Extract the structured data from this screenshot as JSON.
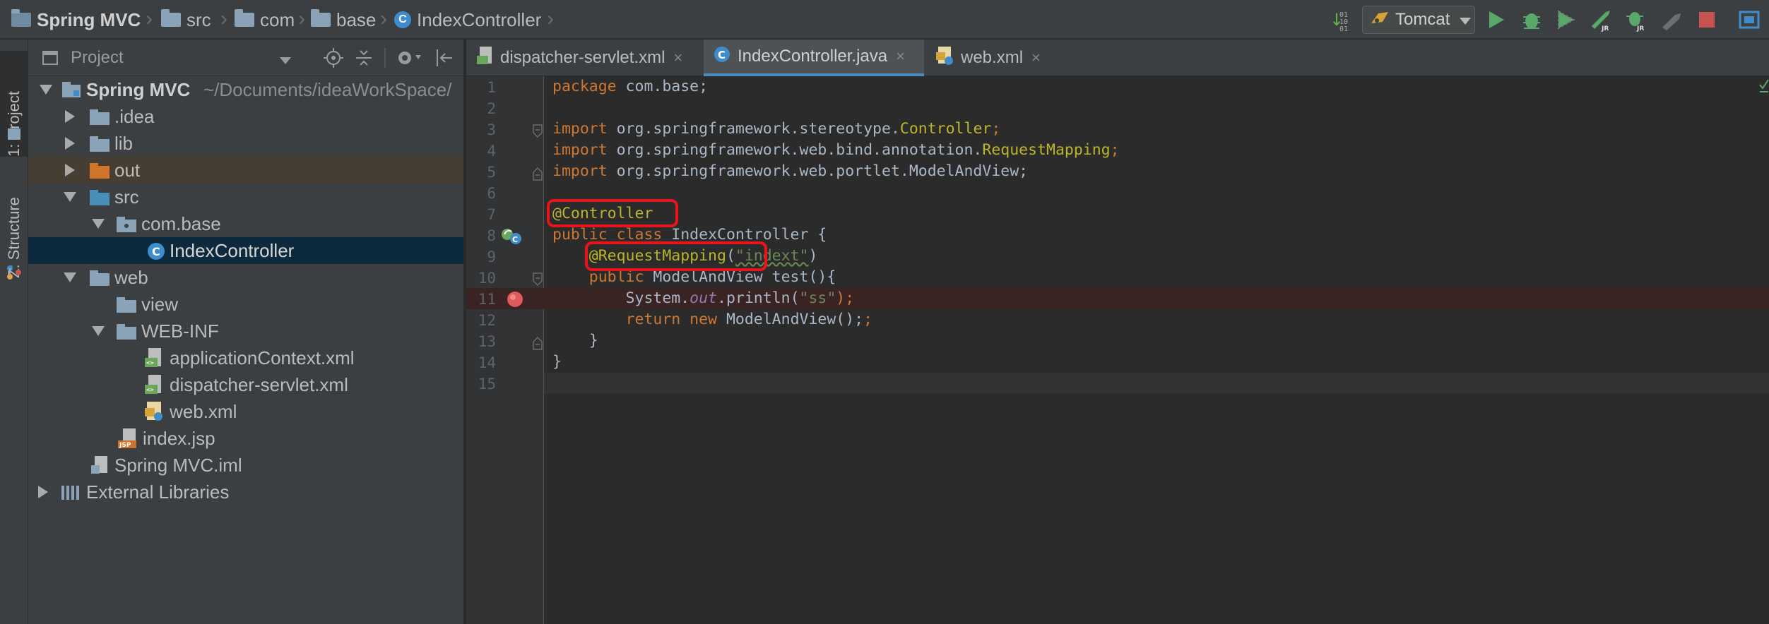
{
  "breadcrumb": {
    "project": "Spring MVC",
    "items": [
      "src",
      "com",
      "base",
      "IndexController"
    ]
  },
  "toolbar": {
    "run_config": "Tomcat",
    "icons": [
      "sort-icon",
      "tomcat-icon",
      "run-icon",
      "debug-icon",
      "coverage-icon",
      "jrebel-run-icon",
      "jrebel-debug-icon",
      "attach-icon",
      "stop-icon",
      "layout-icon"
    ]
  },
  "toolstrip": {
    "project_tab": "1: Project",
    "structure_tab": "Z: Structure"
  },
  "project_panel": {
    "title": "Project",
    "tree": [
      {
        "label": "Spring MVC",
        "suffix": "~/Documents/ideaWorkSpace/",
        "icon": "module-icon"
      },
      {
        "label": ".idea",
        "icon": "folder-icon"
      },
      {
        "label": "lib",
        "icon": "folder-icon"
      },
      {
        "label": "out",
        "icon": "excluded-folder-icon"
      },
      {
        "label": "src",
        "icon": "source-folder-icon"
      },
      {
        "label": "com.base",
        "icon": "package-icon"
      },
      {
        "label": "IndexController",
        "icon": "class-icon"
      },
      {
        "label": "web",
        "icon": "folder-icon"
      },
      {
        "label": "view",
        "icon": "folder-icon"
      },
      {
        "label": "WEB-INF",
        "icon": "folder-icon"
      },
      {
        "label": "applicationContext.xml",
        "icon": "spring-xml-icon"
      },
      {
        "label": "dispatcher-servlet.xml",
        "icon": "spring-xml-icon"
      },
      {
        "label": "web.xml",
        "icon": "web-xml-icon"
      },
      {
        "label": "index.jsp",
        "icon": "jsp-icon"
      },
      {
        "label": "Spring MVC.iml",
        "icon": "iml-icon"
      },
      {
        "label": "External Libraries",
        "icon": "libraries-icon"
      }
    ]
  },
  "editor": {
    "tabs": [
      {
        "label": "dispatcher-servlet.xml",
        "close": "×"
      },
      {
        "label": "IndexController.java",
        "close": "×"
      },
      {
        "label": "web.xml",
        "close": "×"
      }
    ],
    "line_numbers": [
      "1",
      "2",
      "3",
      "4",
      "5",
      "6",
      "7",
      "8",
      "9",
      "10",
      "11",
      "12",
      "13",
      "14",
      "15"
    ],
    "code": {
      "l1_kw": "package",
      "l1_rest": " com.base;",
      "l3_kw": "import",
      "l3_pkg": " org.springframework.stereotype.",
      "l3_cls": "Controller",
      "l3_end": ";",
      "l4_kw": "import",
      "l4_pkg": " org.springframework.web.bind.annotation.",
      "l4_cls": "RequestMapping",
      "l4_end": ";",
      "l5_kw": "import",
      "l5_rest": " org.springframework.web.portlet.ModelAndView;",
      "l7_ann": "@Controller",
      "l8_kw": "public class",
      "l8_rest": " IndexController {",
      "l9_indent": "    ",
      "l9_ann": "@RequestMapping",
      "l9_open": "(",
      "l9_str": "\"indext\"",
      "l9_close": ")",
      "l10_indent": "    ",
      "l10_kw": "public",
      "l10_rest": " ModelAndView test(){",
      "l11_pre": "        System.",
      "l11_out": "out",
      "l11_mid": ".println(",
      "l11_str": "\"ss\"",
      "l11_end": ");",
      "l12_indent": "        ",
      "l12_kw": "return new",
      "l12_rest": " ModelAndView();",
      "l13": "    }",
      "l14": "}"
    }
  }
}
